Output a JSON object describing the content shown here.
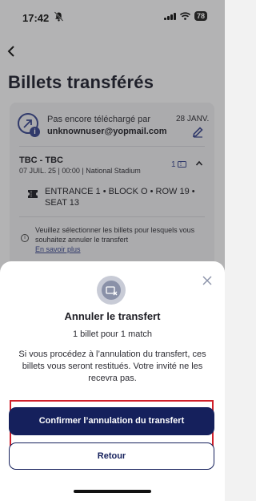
{
  "status_bar": {
    "time": "17:42",
    "battery": "78"
  },
  "page": {
    "title": "Billets transférés"
  },
  "transfer": {
    "status_text": "Pas encore téléchargé par",
    "email": "unknownuser@yopmail.com",
    "date": "28 JANV."
  },
  "match": {
    "title": "TBC - TBC",
    "info": "07 JUIL. 25 | 00:00 | National Stadium",
    "ticket_count": "1",
    "seat": "ENTRANCE 1 • BLOCK O • ROW 19 • SEAT 13"
  },
  "notice": {
    "text": "Veuillez sélectionner les billets pour lesquels vous souhaitez annuler le transfert",
    "link": "En savoir plus"
  },
  "modal": {
    "title": "Annuler le transfert",
    "subtitle": "1 billet pour 1 match",
    "body": "Si vous procédez à l’annulation du transfert, ces billets vous seront restitués. Votre invité ne les recevra pas.",
    "confirm_label": "Confirmer l’annulation du transfert",
    "back_label": "Retour"
  },
  "colors": {
    "primary": "#15205c",
    "accent": "#35438b",
    "highlight": "#d0202a"
  },
  "icons": [
    "bell-off-icon",
    "back-arrow-icon",
    "transfer-icon",
    "edit-icon",
    "ticket-icon",
    "chevron-up-icon",
    "info-icon",
    "close-icon",
    "cancel-transfer-icon"
  ]
}
